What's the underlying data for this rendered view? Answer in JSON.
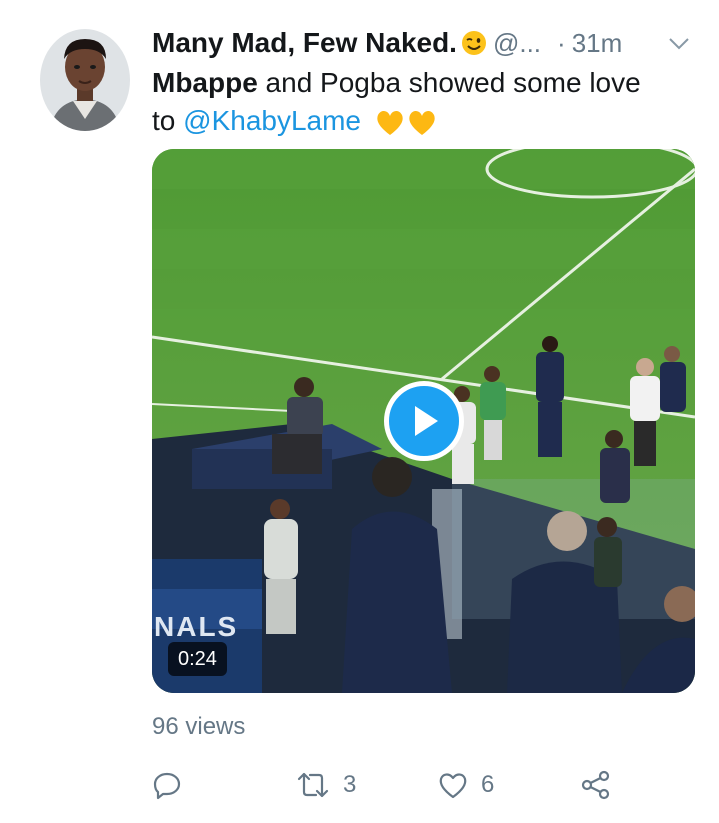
{
  "tweet": {
    "author_name": "Many Mad, Few Naked.",
    "author_handle": "@...",
    "separator": "·",
    "time": "31m",
    "text_bold": "Mbappe",
    "text_rest": " and Pogba showed some love",
    "text_to": "to ",
    "mention": "@KhabyLame",
    "emojis": [
      "winking-face",
      "yellow-heart",
      "yellow-heart"
    ]
  },
  "media": {
    "duration": "0:24",
    "banner_text": "NALS"
  },
  "stats": {
    "views": "96 views",
    "retweets": "3",
    "likes": "6"
  },
  "colors": {
    "link": "#1b95e0",
    "play_button": "#1da1f2",
    "secondary_text": "#657786",
    "pitch": "#5a9b3f"
  }
}
